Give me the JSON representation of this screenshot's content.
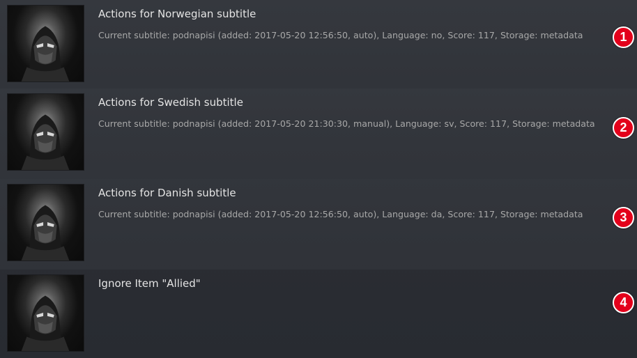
{
  "rows": [
    {
      "title": "Actions for Norwegian subtitle",
      "subtitle": "Current subtitle: podnapisi (added: 2017-05-20 12:56:50, auto), Language: no, Score: 117, Storage: metadata",
      "badge": "1"
    },
    {
      "title": "Actions for Swedish subtitle",
      "subtitle": "Current subtitle: podnapisi (added: 2017-05-20 21:30:30, manual), Language: sv, Score: 117, Storage: metadata",
      "badge": "2"
    },
    {
      "title": "Actions for Danish subtitle",
      "subtitle": "Current subtitle: podnapisi (added: 2017-05-20 12:56:50, auto), Language: da, Score: 117, Storage: metadata",
      "badge": "3"
    },
    {
      "title": "Ignore Item \"Allied\"",
      "subtitle": "",
      "badge": "4"
    }
  ],
  "colors": {
    "badge_fill": "#e3001b",
    "badge_border": "#ffffff",
    "title_text": "#e4e4e4",
    "subtitle_text": "#a8a8a8"
  },
  "icons": {
    "thumbnail": "masked-ninja-thumbnail"
  }
}
